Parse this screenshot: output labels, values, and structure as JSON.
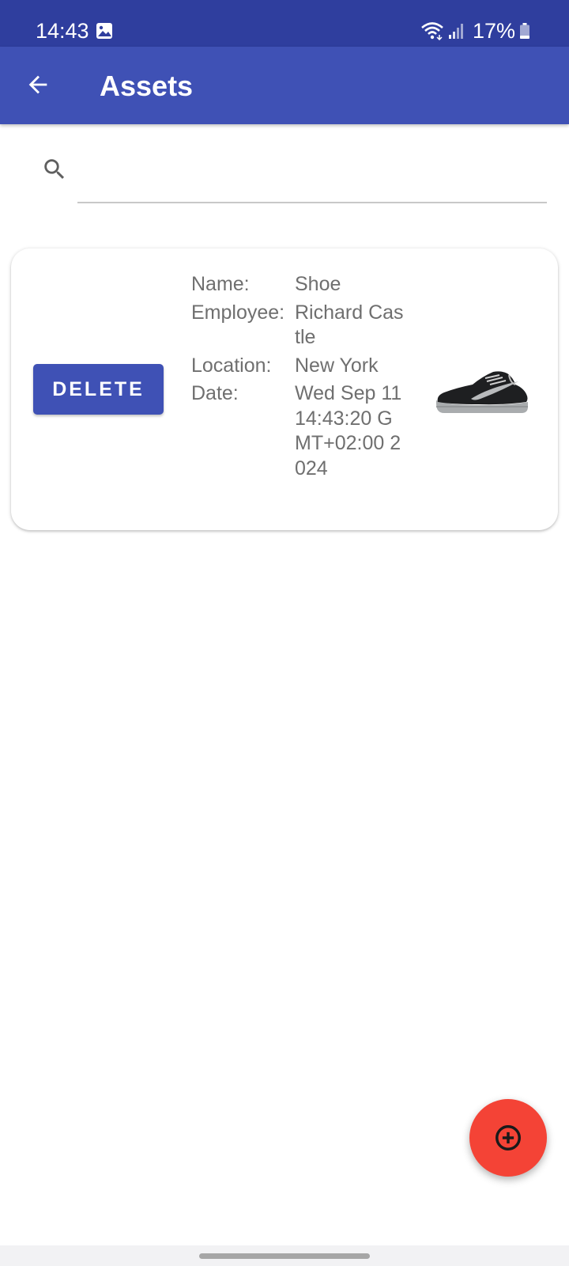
{
  "status_bar": {
    "time": "14:43",
    "battery_percent": "17%",
    "icons": [
      "gallery-icon",
      "wifi-icon",
      "signal-icon",
      "battery-icon"
    ]
  },
  "app_bar": {
    "title": "Assets",
    "back_icon": "arrow-left-icon",
    "color": "#3f51b5"
  },
  "search": {
    "icon": "search-icon",
    "value": "",
    "placeholder": ""
  },
  "assets": [
    {
      "delete_label": "DELETE",
      "name_label": "Name:",
      "name": "Shoe",
      "employee_label": "Employee:",
      "employee": "Richard Castle",
      "location_label": "Location:",
      "location": "New York",
      "date_label": "Date:",
      "date": "Wed Sep 11 14:43:20 GMT+02:00 2024",
      "image": "shoe-image"
    }
  ],
  "fab": {
    "icon": "add-circle-icon",
    "color": "#f44336"
  }
}
